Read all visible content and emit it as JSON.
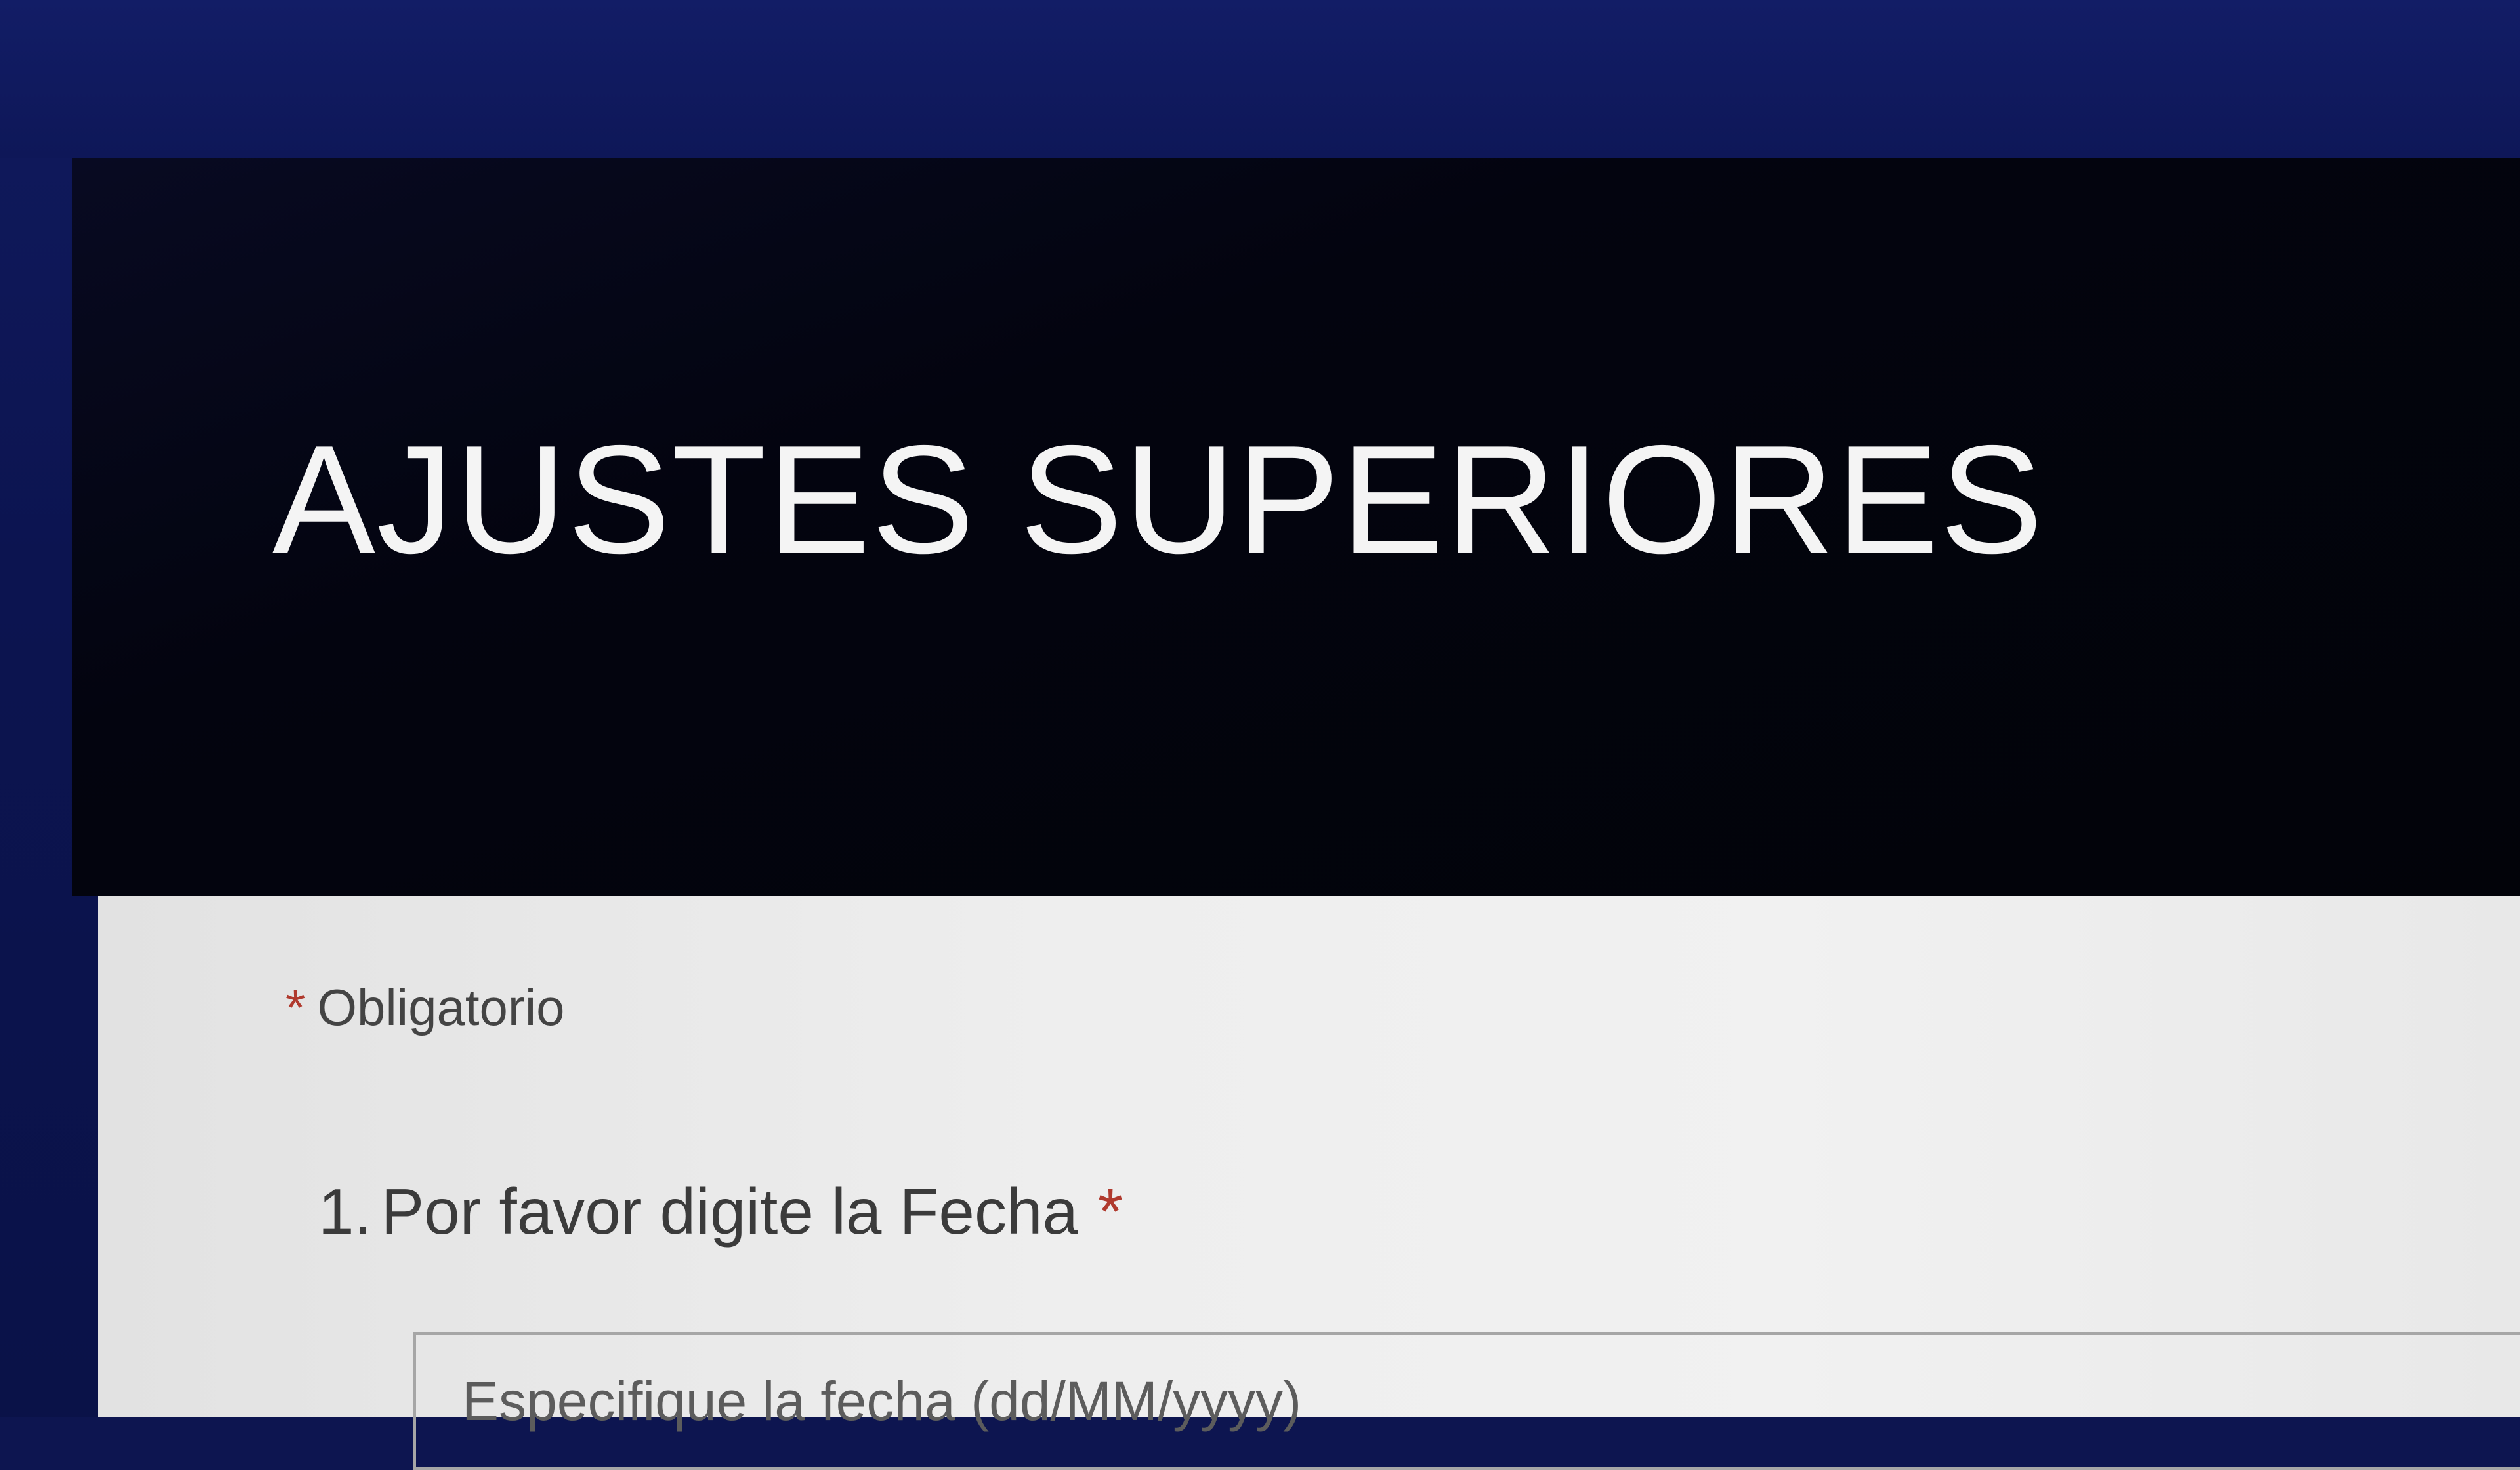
{
  "form": {
    "title": "AJUSTES SUPERIORES",
    "required_note": {
      "marker": "*",
      "text": "Obligatorio"
    },
    "questions": [
      {
        "number": "1.",
        "label": "Por favor digite la Fecha",
        "required_marker": "*",
        "input": {
          "value": "",
          "placeholder": "Especifique la fecha (dd/MM/yyyy)"
        }
      }
    ]
  },
  "colors": {
    "header_background": "#03040f",
    "title_text": "#f4f4f4",
    "body_background": "#eeeeee",
    "required_star": "#b03a2e",
    "input_border": "#a6a6a6"
  }
}
